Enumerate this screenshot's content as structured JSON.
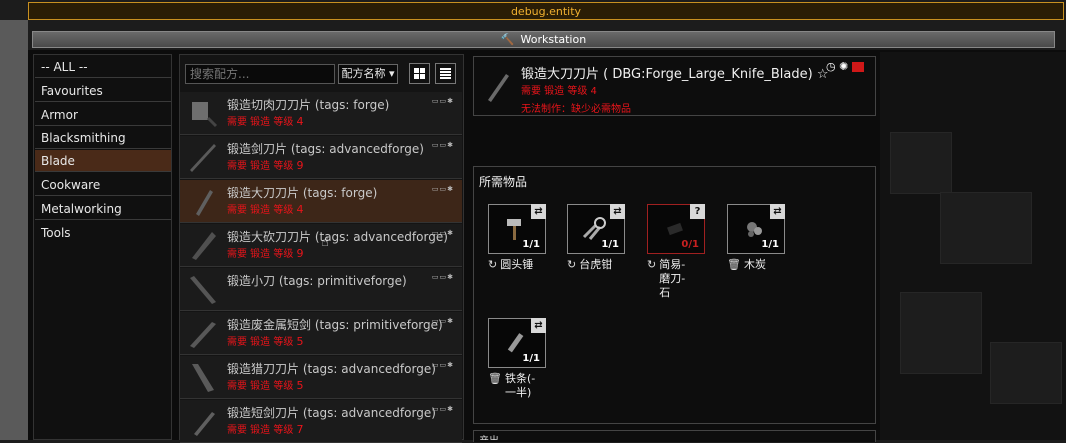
{
  "debug_title": "debug.entity",
  "workstation": {
    "title": "Workstation",
    "icon": "hammer-icon"
  },
  "categories": [
    {
      "label": "-- ALL --"
    },
    {
      "label": "Favourites"
    },
    {
      "label": "Armor"
    },
    {
      "label": "Blacksmithing"
    },
    {
      "label": "Blade",
      "selected": true
    },
    {
      "label": "Cookware"
    },
    {
      "label": "Metalworking"
    },
    {
      "label": "Tools"
    }
  ],
  "search": {
    "placeholder": "搜索配方..."
  },
  "sort": {
    "label": "配方名称 ▾"
  },
  "recipes": [
    {
      "name": "锻造切肉刀刀片 (tags: forge)",
      "req": "需要 锻造 等级",
      "lvl": "4"
    },
    {
      "name": "锻造剑刀片 (tags: advancedforge)",
      "req": "需要 锻造 等级",
      "lvl": "9"
    },
    {
      "name": "锻造大刀刀片 (tags: forge)",
      "req": "需要 锻造 等级",
      "lvl": "4",
      "selected": true
    },
    {
      "name": "锻造大砍刀刀片 (tags: advancedforge)",
      "req": "需要 锻造 等级",
      "lvl": "9"
    },
    {
      "name": "锻造小刀 (tags: primitiveforge)",
      "req": "",
      "lvl": ""
    },
    {
      "name": "锻造废金属短剑 (tags: primitiveforge)",
      "req": "需要 锻造 等级",
      "lvl": "5"
    },
    {
      "name": "锻造猎刀刀片 (tags: advancedforge)",
      "req": "需要 锻造 等级",
      "lvl": "5"
    },
    {
      "name": "锻造短剑刀片 (tags: advancedforge)",
      "req": "需要 锻造 等级",
      "lvl": "7"
    }
  ],
  "detail": {
    "title": "锻造大刀刀片 ( DBG:Forge_Large_Knife_Blade)",
    "req": "需要 锻造 等级",
    "lvl": "4",
    "cannot": "无法制作：缺少必需物品",
    "star": "☆"
  },
  "required": {
    "title": "所需物品",
    "items": [
      {
        "label": "圆头锤",
        "count": "1/1",
        "icon": "hammer-icon",
        "tag": "↻"
      },
      {
        "label": "台虎钳",
        "count": "1/1",
        "icon": "pliers-icon",
        "tag": "↻"
      },
      {
        "label": "简易-磨刀-石",
        "count": "0/1",
        "icon": "whetstone-icon",
        "tag": "↻",
        "missing": true
      },
      {
        "label": "木炭",
        "count": "1/1",
        "icon": "charcoal-icon",
        "tag": "🗑"
      },
      {
        "label": "铁条(-一半)",
        "count": "1/1",
        "icon": "iron-bar-icon",
        "tag": "🗑"
      }
    ]
  },
  "next_section": {
    "title": "产出"
  },
  "colors": {
    "accent": "#c89020",
    "selected": "#3d2618",
    "warning": "#e8141a"
  }
}
